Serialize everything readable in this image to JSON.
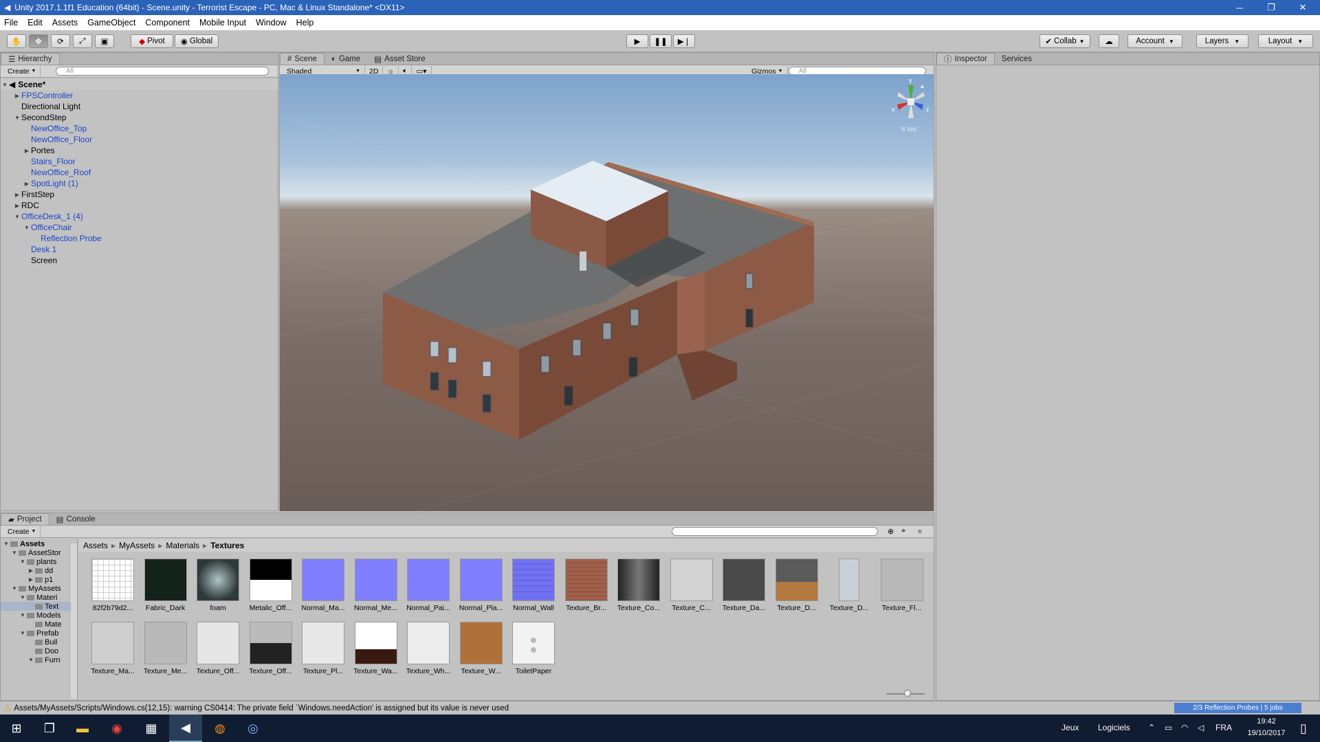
{
  "window": {
    "title": "Unity 2017.1.1f1 Education (64bit) - Scene.unity - Terrorist Escape - PC, Mac & Linux Standalone* <DX11>"
  },
  "menu": [
    "File",
    "Edit",
    "Assets",
    "GameObject",
    "Component",
    "Mobile Input",
    "Window",
    "Help"
  ],
  "toolbar": {
    "pivot": "Pivot",
    "global": "Global",
    "collab": "Collab",
    "account": "Account",
    "layers": "Layers",
    "layout": "Layout"
  },
  "hierarchy": {
    "tab": "Hierarchy",
    "create": "Create",
    "search_placeholder": "All",
    "scene": "Scene*",
    "items": [
      {
        "label": "FPSController",
        "depth": 1,
        "arrow": "right",
        "blue": true
      },
      {
        "label": "Directional Light",
        "depth": 1,
        "arrow": "",
        "blue": false
      },
      {
        "label": "SecondStep",
        "depth": 1,
        "arrow": "down",
        "blue": false
      },
      {
        "label": "NewOffice_Top",
        "depth": 2,
        "arrow": "",
        "blue": true
      },
      {
        "label": "NewOffice_Floor",
        "depth": 2,
        "arrow": "",
        "blue": true
      },
      {
        "label": "Portes",
        "depth": 2,
        "arrow": "right",
        "blue": false
      },
      {
        "label": "Stairs_Floor",
        "depth": 2,
        "arrow": "",
        "blue": true
      },
      {
        "label": "NewOffice_Roof",
        "depth": 2,
        "arrow": "",
        "blue": true
      },
      {
        "label": "SpotLight (1)",
        "depth": 2,
        "arrow": "right",
        "blue": true
      },
      {
        "label": "FirstStep",
        "depth": 1,
        "arrow": "right",
        "blue": false
      },
      {
        "label": "RDC",
        "depth": 1,
        "arrow": "right",
        "blue": false
      },
      {
        "label": "OfficeDesk_1 (4)",
        "depth": 1,
        "arrow": "down",
        "blue": true
      },
      {
        "label": "OfficeChair",
        "depth": 2,
        "arrow": "down",
        "blue": true
      },
      {
        "label": "Reflection Probe",
        "depth": 3,
        "arrow": "",
        "blue": true
      },
      {
        "label": "Desk 1",
        "depth": 2,
        "arrow": "",
        "blue": true
      },
      {
        "label": "Screen",
        "depth": 2,
        "arrow": "",
        "blue": false
      }
    ]
  },
  "scene_view": {
    "tabs": [
      "Scene",
      "Game",
      "Asset Store"
    ],
    "shading": "Shaded",
    "mode_2d": "2D",
    "gizmos": "Gizmos",
    "search_placeholder": "All",
    "iso": "Iso",
    "axis_y": "y",
    "axis_x": "x",
    "axis_z": "z"
  },
  "inspector": {
    "tabs": [
      "Inspector",
      "Services"
    ]
  },
  "project": {
    "tabs": [
      "Project",
      "Console"
    ],
    "create": "Create",
    "breadcrumb": [
      "Assets",
      "MyAssets",
      "Materials",
      "Textures"
    ],
    "tree": [
      {
        "label": "Assets",
        "depth": 0,
        "arrow": "down",
        "bold": true
      },
      {
        "label": "AssetStor",
        "depth": 1,
        "arrow": "down",
        "bold": false
      },
      {
        "label": "plants",
        "depth": 2,
        "arrow": "down",
        "bold": false
      },
      {
        "label": "dd",
        "depth": 3,
        "arrow": "right",
        "bold": false
      },
      {
        "label": "p1",
        "depth": 3,
        "arrow": "right",
        "bold": false
      },
      {
        "label": "MyAssets",
        "depth": 1,
        "arrow": "down",
        "bold": false
      },
      {
        "label": "Materi",
        "depth": 2,
        "arrow": "down",
        "bold": false
      },
      {
        "label": "Text",
        "depth": 3,
        "arrow": "",
        "bold": false
      },
      {
        "label": "Models",
        "depth": 2,
        "arrow": "down",
        "bold": false
      },
      {
        "label": "Mate",
        "depth": 3,
        "arrow": "",
        "bold": false
      },
      {
        "label": "Prefab",
        "depth": 2,
        "arrow": "down",
        "bold": false
      },
      {
        "label": "Buil",
        "depth": 3,
        "arrow": "",
        "bold": false
      },
      {
        "label": "Doo",
        "depth": 3,
        "arrow": "",
        "bold": false
      },
      {
        "label": "Furn",
        "depth": 3,
        "arrow": "down",
        "bold": false
      }
    ],
    "assets_row1": [
      {
        "label": "82f2b79d2...",
        "color": "#ffffff",
        "kind": "grid"
      },
      {
        "label": "Fabric_Dark",
        "color": "#14221c",
        "kind": "solid"
      },
      {
        "label": "foam",
        "color": "#3b4a4a",
        "kind": "foam"
      },
      {
        "label": "Metalic_Off...",
        "color": "#000000",
        "kind": "split"
      },
      {
        "label": "Normal_Ma...",
        "color": "#7f7fff",
        "kind": "solid"
      },
      {
        "label": "Normal_Me...",
        "color": "#7f7fff",
        "kind": "solid"
      },
      {
        "label": "Normal_Pai...",
        "color": "#7f7fff",
        "kind": "solid"
      },
      {
        "label": "Normal_Pla...",
        "color": "#7f7fff",
        "kind": "solid"
      },
      {
        "label": "Normal_Wall",
        "color": "#7070f0",
        "kind": "wall"
      },
      {
        "label": "Texture_Br...",
        "color": "#a0604a",
        "kind": "brick"
      },
      {
        "label": "Texture_Co...",
        "color": "#3a3a3a",
        "kind": "dark"
      },
      {
        "label": "Texture_C...",
        "color": "#d2d2d2",
        "kind": "solid"
      },
      {
        "label": "Texture_Da...",
        "color": "#4a4a4a",
        "kind": "solid"
      },
      {
        "label": "Texture_D...",
        "color": "#5a5a5a",
        "kind": "wood2"
      },
      {
        "label": "Texture_D...",
        "color": "#bcc6cc",
        "kind": "door"
      },
      {
        "label": "Texture_Fl...",
        "color": "#b8b8b8",
        "kind": "solid"
      }
    ],
    "assets_row2": [
      {
        "label": "Texture_Ma...",
        "color": "#cfcfcf",
        "kind": "solid"
      },
      {
        "label": "Texture_Me...",
        "color": "#b9b9b9",
        "kind": "solid"
      },
      {
        "label": "Texture_Off...",
        "color": "#e6e6e6",
        "kind": "solid"
      },
      {
        "label": "Texture_Off...",
        "color": "#9a9a9a",
        "kind": "quad"
      },
      {
        "label": "Texture_Pl...",
        "color": "#e8e8e8",
        "kind": "solid"
      },
      {
        "label": "Texture_Wa...",
        "color": "#ffffff",
        "kind": "wa"
      },
      {
        "label": "Texture_Wh...",
        "color": "#ececec",
        "kind": "solid"
      },
      {
        "label": "Texture_W...",
        "color": "#b0703a",
        "kind": "solid"
      },
      {
        "label": "ToiletPaper",
        "color": "#f2f2f2",
        "kind": "toilet"
      }
    ]
  },
  "status": {
    "warning": "Assets/MyAssets/Scripts/Windows.cs(12,15): warning CS0414: The private field `Windows.needAction' is assigned but its value is never used",
    "probes": "2/3 Reflection Probes | 5 jobs"
  },
  "taskbar": {
    "jeux": "Jeux",
    "logiciels": "Logiciels",
    "lang": "FRA",
    "time": "19:42",
    "date": "19/10/2017"
  }
}
